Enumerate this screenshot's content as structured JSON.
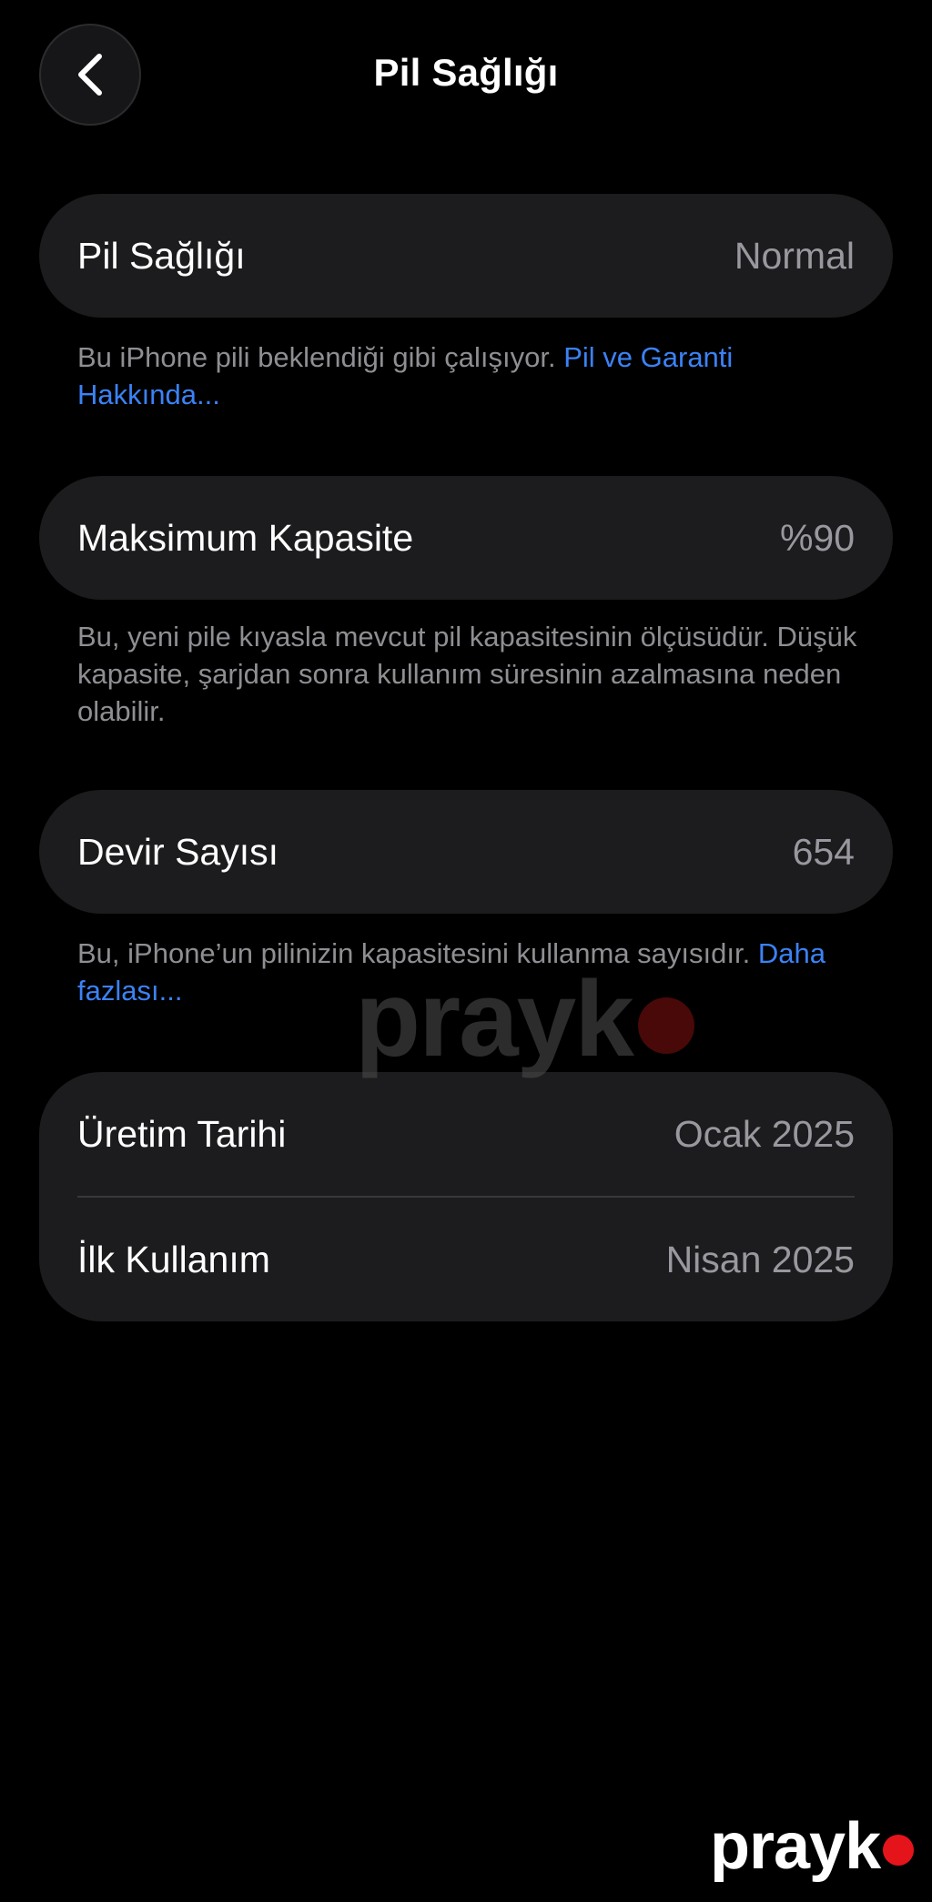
{
  "nav": {
    "title": "Pil Sağlığı",
    "back_icon": "chevron-left-icon"
  },
  "health": {
    "label": "Pil Sağlığı",
    "value": "Normal",
    "note_text": "Bu iPhone pili beklendiği gibi çalışıyor. ",
    "note_link": "Pil ve Garanti Hakkında..."
  },
  "capacity": {
    "label": "Maksimum Kapasite",
    "value": "%90",
    "note_text": "Bu, yeni pile kıyasla mevcut pil kapasitesinin ölçüsüdür. Düşük kapasite, şarjdan sonra kullanım süresinin azalmasına neden olabilir."
  },
  "cycles": {
    "label": "Devir Sayısı",
    "value": "654",
    "note_text": "Bu, iPhone’un pilinizin kapasitesini kullanma sayısıdır. ",
    "note_link": "Daha fazlası..."
  },
  "dates": {
    "manufacture_label": "Üretim Tarihi",
    "manufacture_value": "Ocak 2025",
    "first_use_label": "İlk Kullanım",
    "first_use_value": "Nisan 2025"
  },
  "watermark": {
    "text": "prayk",
    "dot_color": "#e5141b"
  },
  "colors": {
    "background": "#000000",
    "card": "#1c1c1e",
    "link": "#3b82f6",
    "secondary_text": "#8e8e93"
  }
}
